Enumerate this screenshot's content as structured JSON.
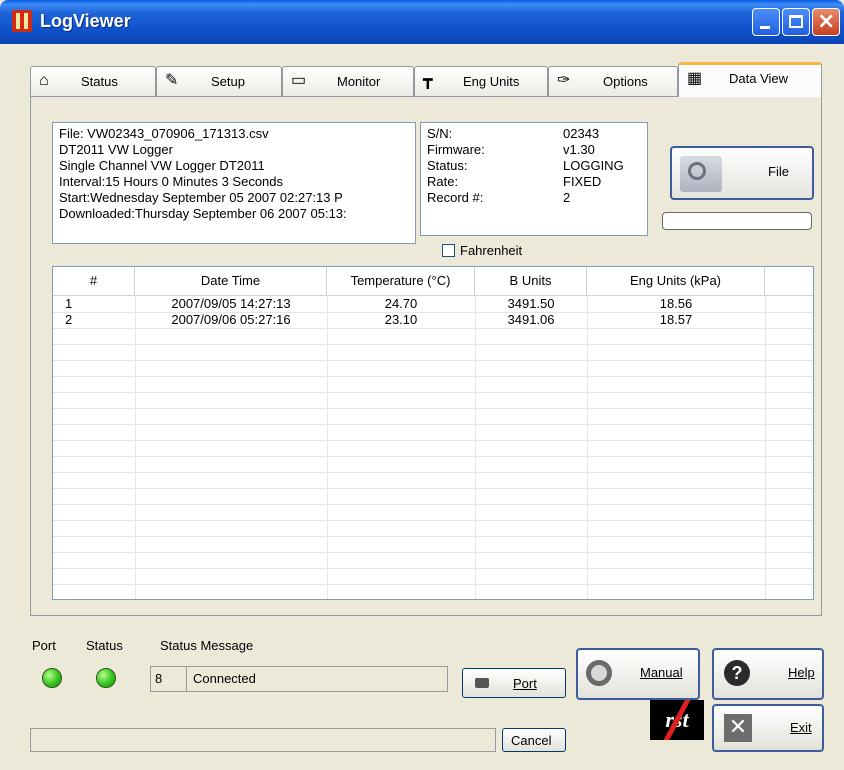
{
  "window": {
    "title": "LogViewer"
  },
  "tabs": [
    {
      "label": "Status",
      "icon": "house-icon"
    },
    {
      "label": "Setup",
      "icon": "form-pencil-icon"
    },
    {
      "label": "Monitor",
      "icon": "monitor-icon"
    },
    {
      "label": "Eng Units",
      "icon": "ruler-icon"
    },
    {
      "label": "Options",
      "icon": "wrench-icon"
    },
    {
      "label": "Data View",
      "icon": "table-icon",
      "active": true
    }
  ],
  "file_info": [
    "File: VW02343_070906_171313.csv",
    "DT2011 VW Logger",
    "Single Channel VW Logger DT2011",
    "Interval:15 Hours  0 Minutes  3 Seconds",
    "Start:Wednesday  September  05  2007  02:27:13  P",
    "Downloaded:Thursday  September  06  2007  05:13:"
  ],
  "device_info": [
    {
      "key": "S/N:",
      "value": "02343"
    },
    {
      "key": "Firmware:",
      "value": "v1.30"
    },
    {
      "key": "Status:",
      "value": "LOGGING"
    },
    {
      "key": "Rate:",
      "value": "FIXED"
    },
    {
      "key": "Record #:",
      "value": "2"
    }
  ],
  "file_button": {
    "label": "File"
  },
  "fahrenheit": {
    "label": "Fahrenheit",
    "checked": false
  },
  "table": {
    "columns": [
      "#",
      "Date Time",
      "Temperature (°C)",
      "B Units",
      "Eng Units (kPa)"
    ],
    "rows": [
      [
        "1",
        "2007/09/05 14:27:13",
        "24.70",
        "3491.50",
        "18.56"
      ],
      [
        "2",
        "2007/09/06 05:27:16",
        "23.10",
        "3491.06",
        "18.57"
      ]
    ]
  },
  "status_area": {
    "port_label": "Port",
    "status_label": "Status",
    "message_label": "Status Message",
    "code": "8",
    "message": "Connected"
  },
  "buttons": {
    "port": "Port",
    "manual": "Manual",
    "help": "Help",
    "exit": "Exit",
    "cancel": "Cancel"
  },
  "logo": "rst",
  "colors": {
    "title_bar": "#0f51c9",
    "active_tab_accent": "#f7b64a",
    "led_green": "#33c31e"
  }
}
